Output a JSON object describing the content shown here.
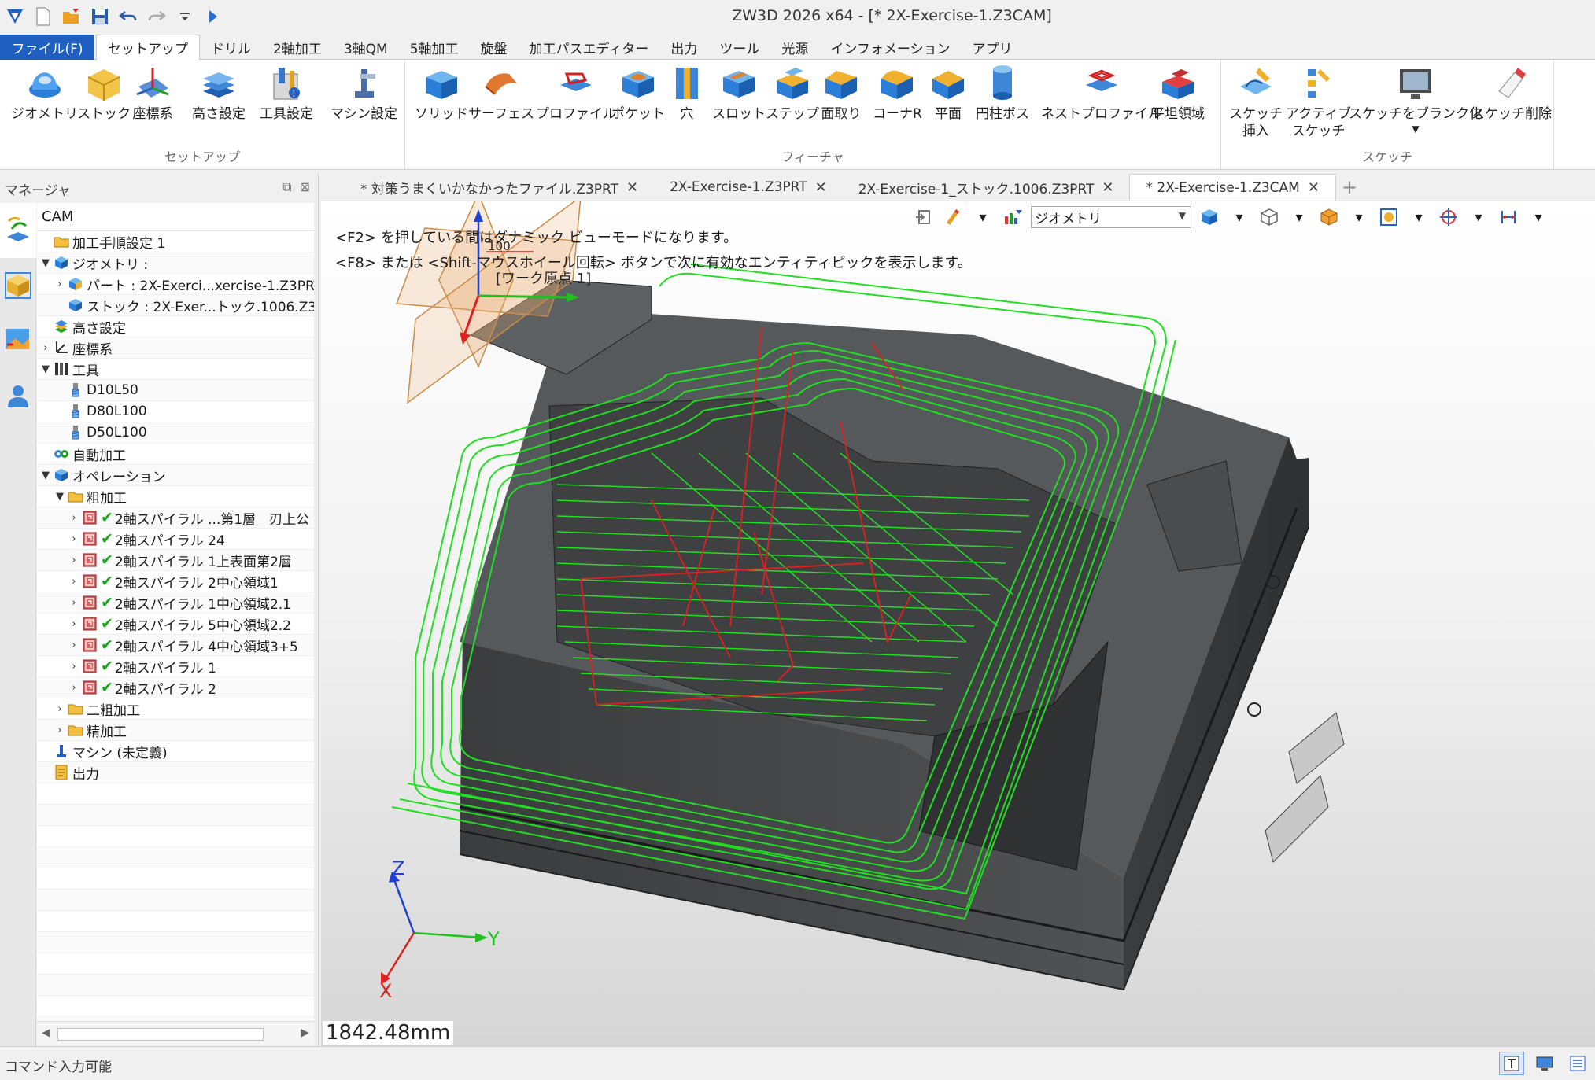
{
  "window": {
    "title": "ZW3D 2026 x64  - [* 2X-Exercise-1.Z3CAM]"
  },
  "menu": {
    "file": "ファイル(F)",
    "tabs": [
      "セットアップ",
      "ドリル",
      "2軸加工",
      "3軸QM",
      "5軸加工",
      "旋盤",
      "加工パスエディター",
      "出力",
      "ツール",
      "光源",
      "インフォメーション",
      "アプリ"
    ]
  },
  "ribbon": {
    "groups": {
      "setup": "セットアップ",
      "feature": "フィーチャ",
      "sketch": "スケッチ"
    },
    "setup": [
      "ジオメトリ",
      "ストック",
      "座標系",
      "高さ設定",
      "工具設定",
      "マシン設定"
    ],
    "feature": [
      "ソリッド",
      "サーフェス",
      "プロファイル",
      "ポケット",
      "穴",
      "スロット",
      "ステップ",
      "面取り",
      "コーナR",
      "平面",
      "円柱ボス",
      "ネストプロファイル",
      "平坦領域"
    ],
    "sketch": [
      "スケッチ\n挿入",
      "アクティブ\nスケッチ",
      "スケッチをブランク化",
      "スケッチ削除"
    ]
  },
  "manager": {
    "title": "マネージャ",
    "root": "CAM",
    "tree": [
      {
        "level": 0,
        "toggle": "",
        "icon": "folder-icon",
        "label": "加工手順設定 1",
        "check": false
      },
      {
        "level": 0,
        "toggle": "v",
        "icon": "geometry-icon",
        "label": "ジオメトリ :",
        "check": false
      },
      {
        "level": 1,
        "toggle": ">",
        "icon": "part-icon",
        "label": "パート : 2X-Exerci...xercise-1.Z3PRT",
        "check": false
      },
      {
        "level": 1,
        "toggle": "",
        "icon": "stock-icon",
        "label": "ストック : 2X-Exer...トック.1006.Z3PRT",
        "check": false
      },
      {
        "level": 0,
        "toggle": "",
        "icon": "height-icon",
        "label": "高さ設定",
        "check": false
      },
      {
        "level": 0,
        "toggle": ">",
        "icon": "coordinate-icon",
        "label": "座標系",
        "check": false
      },
      {
        "level": 0,
        "toggle": "v",
        "icon": "tools-icon",
        "label": "工具",
        "check": false
      },
      {
        "level": 1,
        "toggle": "",
        "icon": "tool-icon",
        "label": "D10L50",
        "check": false
      },
      {
        "level": 1,
        "toggle": "",
        "icon": "tool-icon",
        "label": "D80L100",
        "check": false
      },
      {
        "level": 1,
        "toggle": "",
        "icon": "tool-icon",
        "label": "D50L100",
        "check": false
      },
      {
        "level": 0,
        "toggle": "",
        "icon": "auto-machining-icon",
        "label": "自動加工",
        "check": false
      },
      {
        "level": 0,
        "toggle": "v",
        "icon": "operation-icon",
        "label": "オペレーション",
        "check": false
      },
      {
        "level": 1,
        "toggle": "v",
        "icon": "folder-icon",
        "label": "粗加工",
        "check": false
      },
      {
        "level": 2,
        "toggle": ">",
        "icon": "op-icon",
        "label": "2軸スパイラル ...第1層　刃上公",
        "check": true
      },
      {
        "level": 2,
        "toggle": ">",
        "icon": "op-icon",
        "label": "2軸スパイラル 24",
        "check": true
      },
      {
        "level": 2,
        "toggle": ">",
        "icon": "op-icon",
        "label": "2軸スパイラル 1上表面第2層",
        "check": true
      },
      {
        "level": 2,
        "toggle": ">",
        "icon": "op-icon",
        "label": "2軸スパイラル 2中心領域1",
        "check": true
      },
      {
        "level": 2,
        "toggle": ">",
        "icon": "op-icon",
        "label": "2軸スパイラル 1中心領域2.1",
        "check": true
      },
      {
        "level": 2,
        "toggle": ">",
        "icon": "op-icon",
        "label": "2軸スパイラル 5中心領域2.2",
        "check": true
      },
      {
        "level": 2,
        "toggle": ">",
        "icon": "op-icon",
        "label": "2軸スパイラル 4中心領域3+5",
        "check": true
      },
      {
        "level": 2,
        "toggle": ">",
        "icon": "op-icon",
        "label": "2軸スパイラル 1",
        "check": true
      },
      {
        "level": 2,
        "toggle": ">",
        "icon": "op-icon",
        "label": "2軸スパイラル 2",
        "check": true
      },
      {
        "level": 1,
        "toggle": ">",
        "icon": "folder-icon",
        "label": "二粗加工",
        "check": false
      },
      {
        "level": 1,
        "toggle": ">",
        "icon": "folder-icon",
        "label": "精加工",
        "check": false
      },
      {
        "level": 0,
        "toggle": "",
        "icon": "machine-icon",
        "label": "マシン (未定義)",
        "check": false
      },
      {
        "level": 0,
        "toggle": "",
        "icon": "output-icon",
        "label": "出力",
        "check": false
      }
    ]
  },
  "doc_tabs": [
    {
      "label": "* 対策うまくいかなかったファイル.Z3PRT",
      "active": false
    },
    {
      "label": "2X-Exercise-1.Z3PRT",
      "active": false
    },
    {
      "label": "2X-Exercise-1_ストック.1006.Z3PRT",
      "active": false
    },
    {
      "label": "* 2X-Exercise-1.Z3CAM",
      "active": true
    }
  ],
  "viewport": {
    "hint_f2": "<F2> を押している間はダナミック ビューモードになります。",
    "hint_f8": "<F8> または <Shift-マウスホイール回転> ボタンで次に有効なエンティティピックを表示します。",
    "filter_value": "ジオメトリ",
    "origin_label": "[ワーク原点 1]",
    "dimension_label": "100",
    "axis_x": "X",
    "axis_y": "Y",
    "axis_z": "Z",
    "measure": "1842.48mm"
  },
  "status": {
    "text": "コマンド入力可能"
  },
  "colors": {
    "accent": "#1f5fbf",
    "toolpath": "#22dd22",
    "model": "#4a4c4e",
    "check": "#1aa51a"
  }
}
